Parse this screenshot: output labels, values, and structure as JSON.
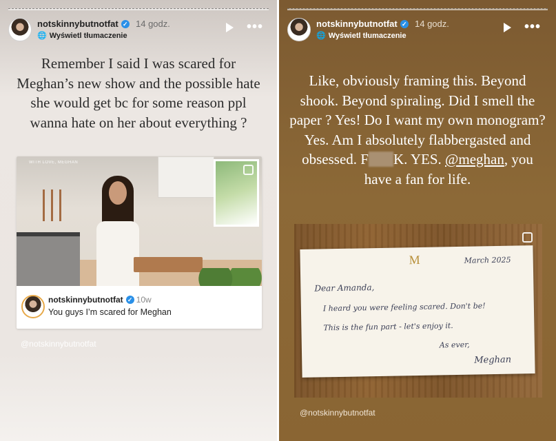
{
  "story_left": {
    "username": "notskinnybutnotfat",
    "verified_mark": "✓",
    "time": "14 godz.",
    "translate_label": "Wyświetl tłumaczenie",
    "translate_icon": "translate-icon",
    "caption": "Remember I said I was scared for Meghan’s new show and the possible hate she would get bc for some reason ppl wanna hate on her about everything ?",
    "repost": {
      "video_watermark": "WITH LOVE, MEGHAN",
      "username": "notskinnybutnotfat",
      "age": "10w",
      "text": "You guys I’m scared for Meghan"
    },
    "handle": "@notskinnybutnotfat"
  },
  "story_right": {
    "username": "notskinnybutnotfat",
    "verified_mark": "✓",
    "time": "14 godz.",
    "translate_label": "Wyświetl tłumaczenie",
    "translate_icon": "translate-icon",
    "caption_part1": "Like, obviously framing this. Beyond shook. Beyond spiraling. Did I smell the paper ? Yes! Do I want my own monogram? Yes. Am I absolutely flabbergasted and obsessed. F",
    "caption_part2": "K. YES. ",
    "caption_mention": "@meghan",
    "caption_part3": ", you have  a fan for life.",
    "note": {
      "monogram": "M",
      "date": "March 2025",
      "greeting": "Dear Amanda,",
      "line1": "I heard you were feeling scared. Don't be!",
      "line2": "This is the fun part - let's enjoy it.",
      "closing": "As ever,",
      "signature": "Meghan"
    },
    "handle": "@notskinnybutnotfat"
  },
  "icons": {
    "play": "play-icon",
    "more": "more-options-icon",
    "multi": "multi-image-icon"
  },
  "controls": {
    "more_glyph": "•••"
  }
}
